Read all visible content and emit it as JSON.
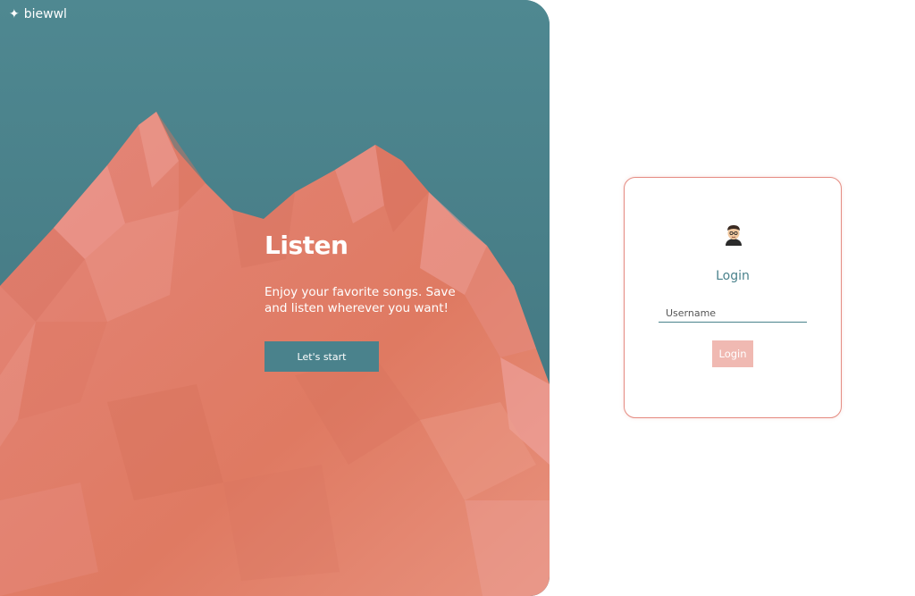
{
  "brand": {
    "icon": "sparkle-icon",
    "name": "biewwl"
  },
  "hero": {
    "title": "Listen",
    "description": "Enjoy your favorite songs. Save and listen wherever you want!",
    "cta_label": "Let's start"
  },
  "login": {
    "avatar_icon": "user-avatar-icon",
    "title": "Login",
    "username_placeholder": "Username",
    "username_value": "",
    "button_label": "Login"
  },
  "colors": {
    "sky": "#4a828c",
    "mountain": "#e0806a",
    "accent_teal": "#4a828c",
    "card_border": "#e58c82",
    "login_button": "#f0b9b2"
  }
}
